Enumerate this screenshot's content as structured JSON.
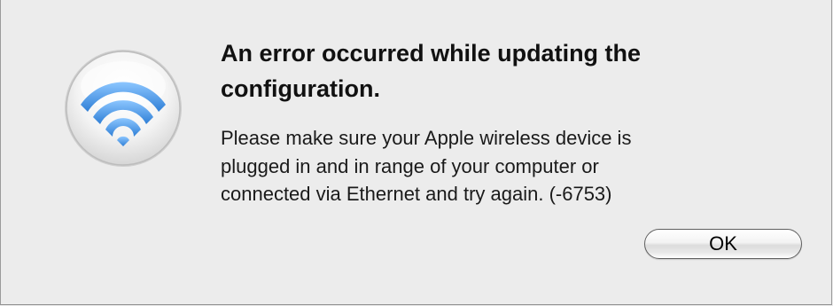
{
  "dialog": {
    "icon": "airport-wifi-icon",
    "title_line1": "An error occurred while updating the",
    "title_line2": "configuration.",
    "message_line1": "Please make sure your Apple wireless device is",
    "message_line2": "plugged in and in range of your computer or",
    "message_line3": "connected via Ethernet and try again. (-6753)",
    "ok_label": "OK"
  },
  "colors": {
    "background": "#ececec",
    "wifi_blue": "#3f8fe0"
  }
}
